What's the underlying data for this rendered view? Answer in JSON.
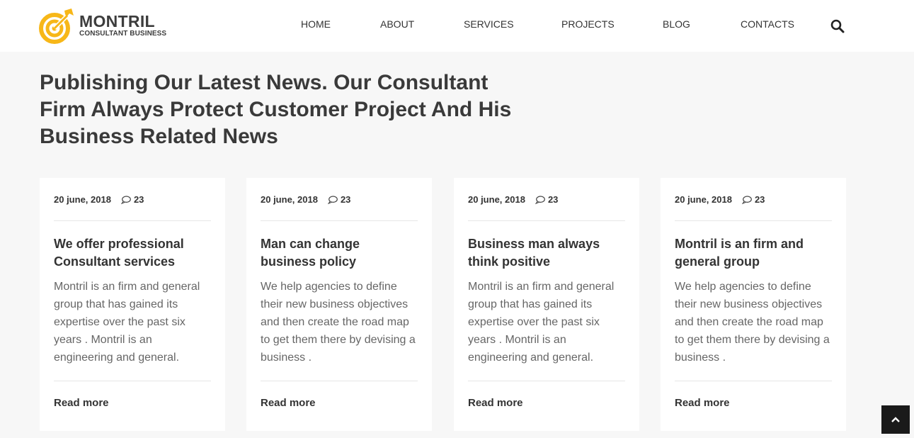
{
  "logo": {
    "name": "MONTRIL",
    "tagline": "CONSULTANT BUSINESS"
  },
  "nav": {
    "items": [
      {
        "label": "HOME"
      },
      {
        "label": "ABOUT"
      },
      {
        "label": "SERVICES"
      },
      {
        "label": "PROJECTS"
      },
      {
        "label": "BLOG"
      },
      {
        "label": "CONTACTS"
      }
    ]
  },
  "search": {
    "icon": "search-icon"
  },
  "page": {
    "title": "Publishing Our Latest News. Our Consultant Firm Always Protect Customer Project And His Business Related News"
  },
  "posts": [
    {
      "date": "20 june, 2018",
      "comments": "23",
      "title": "We offer professional Consultant services",
      "excerpt": "Montril is an firm and general group that has gained its expertise over the past six years . Montril is an engineering and general.",
      "read_more": "Read more"
    },
    {
      "date": "20 june, 2018",
      "comments": "23",
      "title": "Man can change business policy",
      "excerpt": "We help agencies to define their new business objectives and then create the road map to get them there by devising a business .",
      "read_more": "Read more"
    },
    {
      "date": "20 june, 2018",
      "comments": "23",
      "title": "Business man always think positive",
      "excerpt": "Montril is an firm and general group that has gained its expertise over the past six years . Montril is an engineering and general.",
      "read_more": "Read more"
    },
    {
      "date": "20 june, 2018",
      "comments": "23",
      "title": "Montril is an firm and general group",
      "excerpt": "We help agencies to define their new business objectives and then create the road map to get them there by devising a business .",
      "read_more": "Read more"
    }
  ],
  "colors": {
    "accent": "#f7b718",
    "background": "#f7f7f7",
    "text": "#333333"
  }
}
